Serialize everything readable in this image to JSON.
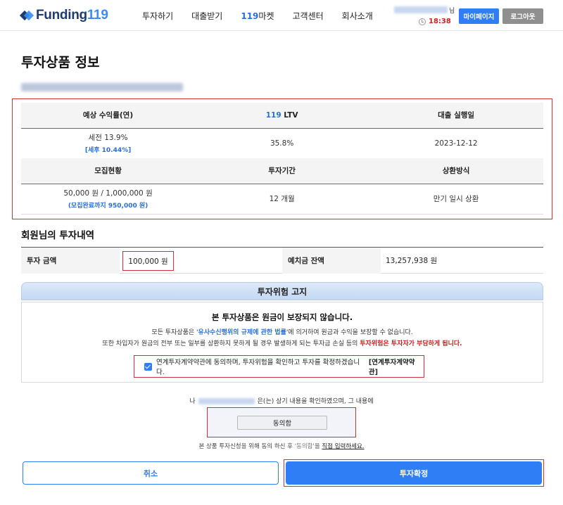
{
  "header": {
    "logo_prefix": "Funding",
    "logo_number": "119",
    "nav": [
      "투자하기",
      "대출받기",
      "마켓",
      "고객센터",
      "회사소개"
    ],
    "nav_market_number": "119",
    "user_suffix": "님",
    "timer": "18:38",
    "mypage_label": "마이페이지",
    "logout_label": "로그아웃"
  },
  "page": {
    "title": "투자상품 정보"
  },
  "product_info": {
    "headers_row1": [
      "예상 수익률(연)",
      "LTV",
      "대출 실행일"
    ],
    "ltv_number": "119",
    "yield_pretax": "세전 13.9%",
    "yield_aftertax": "[세후 10.44%]",
    "ltv_value": "35.8%",
    "loan_date": "2023-12-12",
    "headers_row2": [
      "모집현황",
      "투자기간",
      "상환방식"
    ],
    "recruit_status": "50,000 원 / 1,000,000 원",
    "recruit_remaining": "(모집완료까지 950,000 원)",
    "period": "12 개월",
    "repayment": "만기 일시 상환"
  },
  "investment": {
    "section_title": "회원님의 투자내역",
    "amount_label": "투자 금액",
    "amount_value": "100,000 원",
    "deposit_label": "예치금 잔액",
    "deposit_value": "13,257,938 원"
  },
  "risk": {
    "header": "투자위험 고지",
    "title": "본 투자상품은 원금이 보장되지 않습니다.",
    "line1_pre": "모든 투자상품은 '",
    "line1_law": "유사수신행위의 규제에 관한 법률",
    "line1_post": "'에 의거하여 원금과 수익을 보장할 수 없습니다.",
    "line2_pre": "또한 차입자가 원금의 전부 또는 일부를 상환하지 못하게 될 경우 발생하게 되는 투자금 손실 등의 ",
    "line2_warn": "투자위험은 투자자가 부담하게 됩니다.",
    "agree_text": "연계투자계약약관에 동의하며, 투자위험을 확인하고 투자를 확정하겠습니다.",
    "agree_link": "[연계투자계약약관]"
  },
  "consent": {
    "prefix": "나",
    "suffix": "은(는) 상기 내용을 확인하였으며, 그 내용에",
    "input_value": "동의함",
    "help_pre": "본 상품 투자신청을 위해 동의 하신 후 ",
    "help_quote": "'동의함'",
    "help_mid": "을 ",
    "help_underline": "직접 입력하세요."
  },
  "buttons": {
    "cancel": "취소",
    "confirm": "투자확정"
  },
  "colors": {
    "accent": "#2f7ef6",
    "highlight_border": "#d0323a",
    "warning_text": "#c81f1f",
    "brand_dark": "#1f3c6e"
  }
}
